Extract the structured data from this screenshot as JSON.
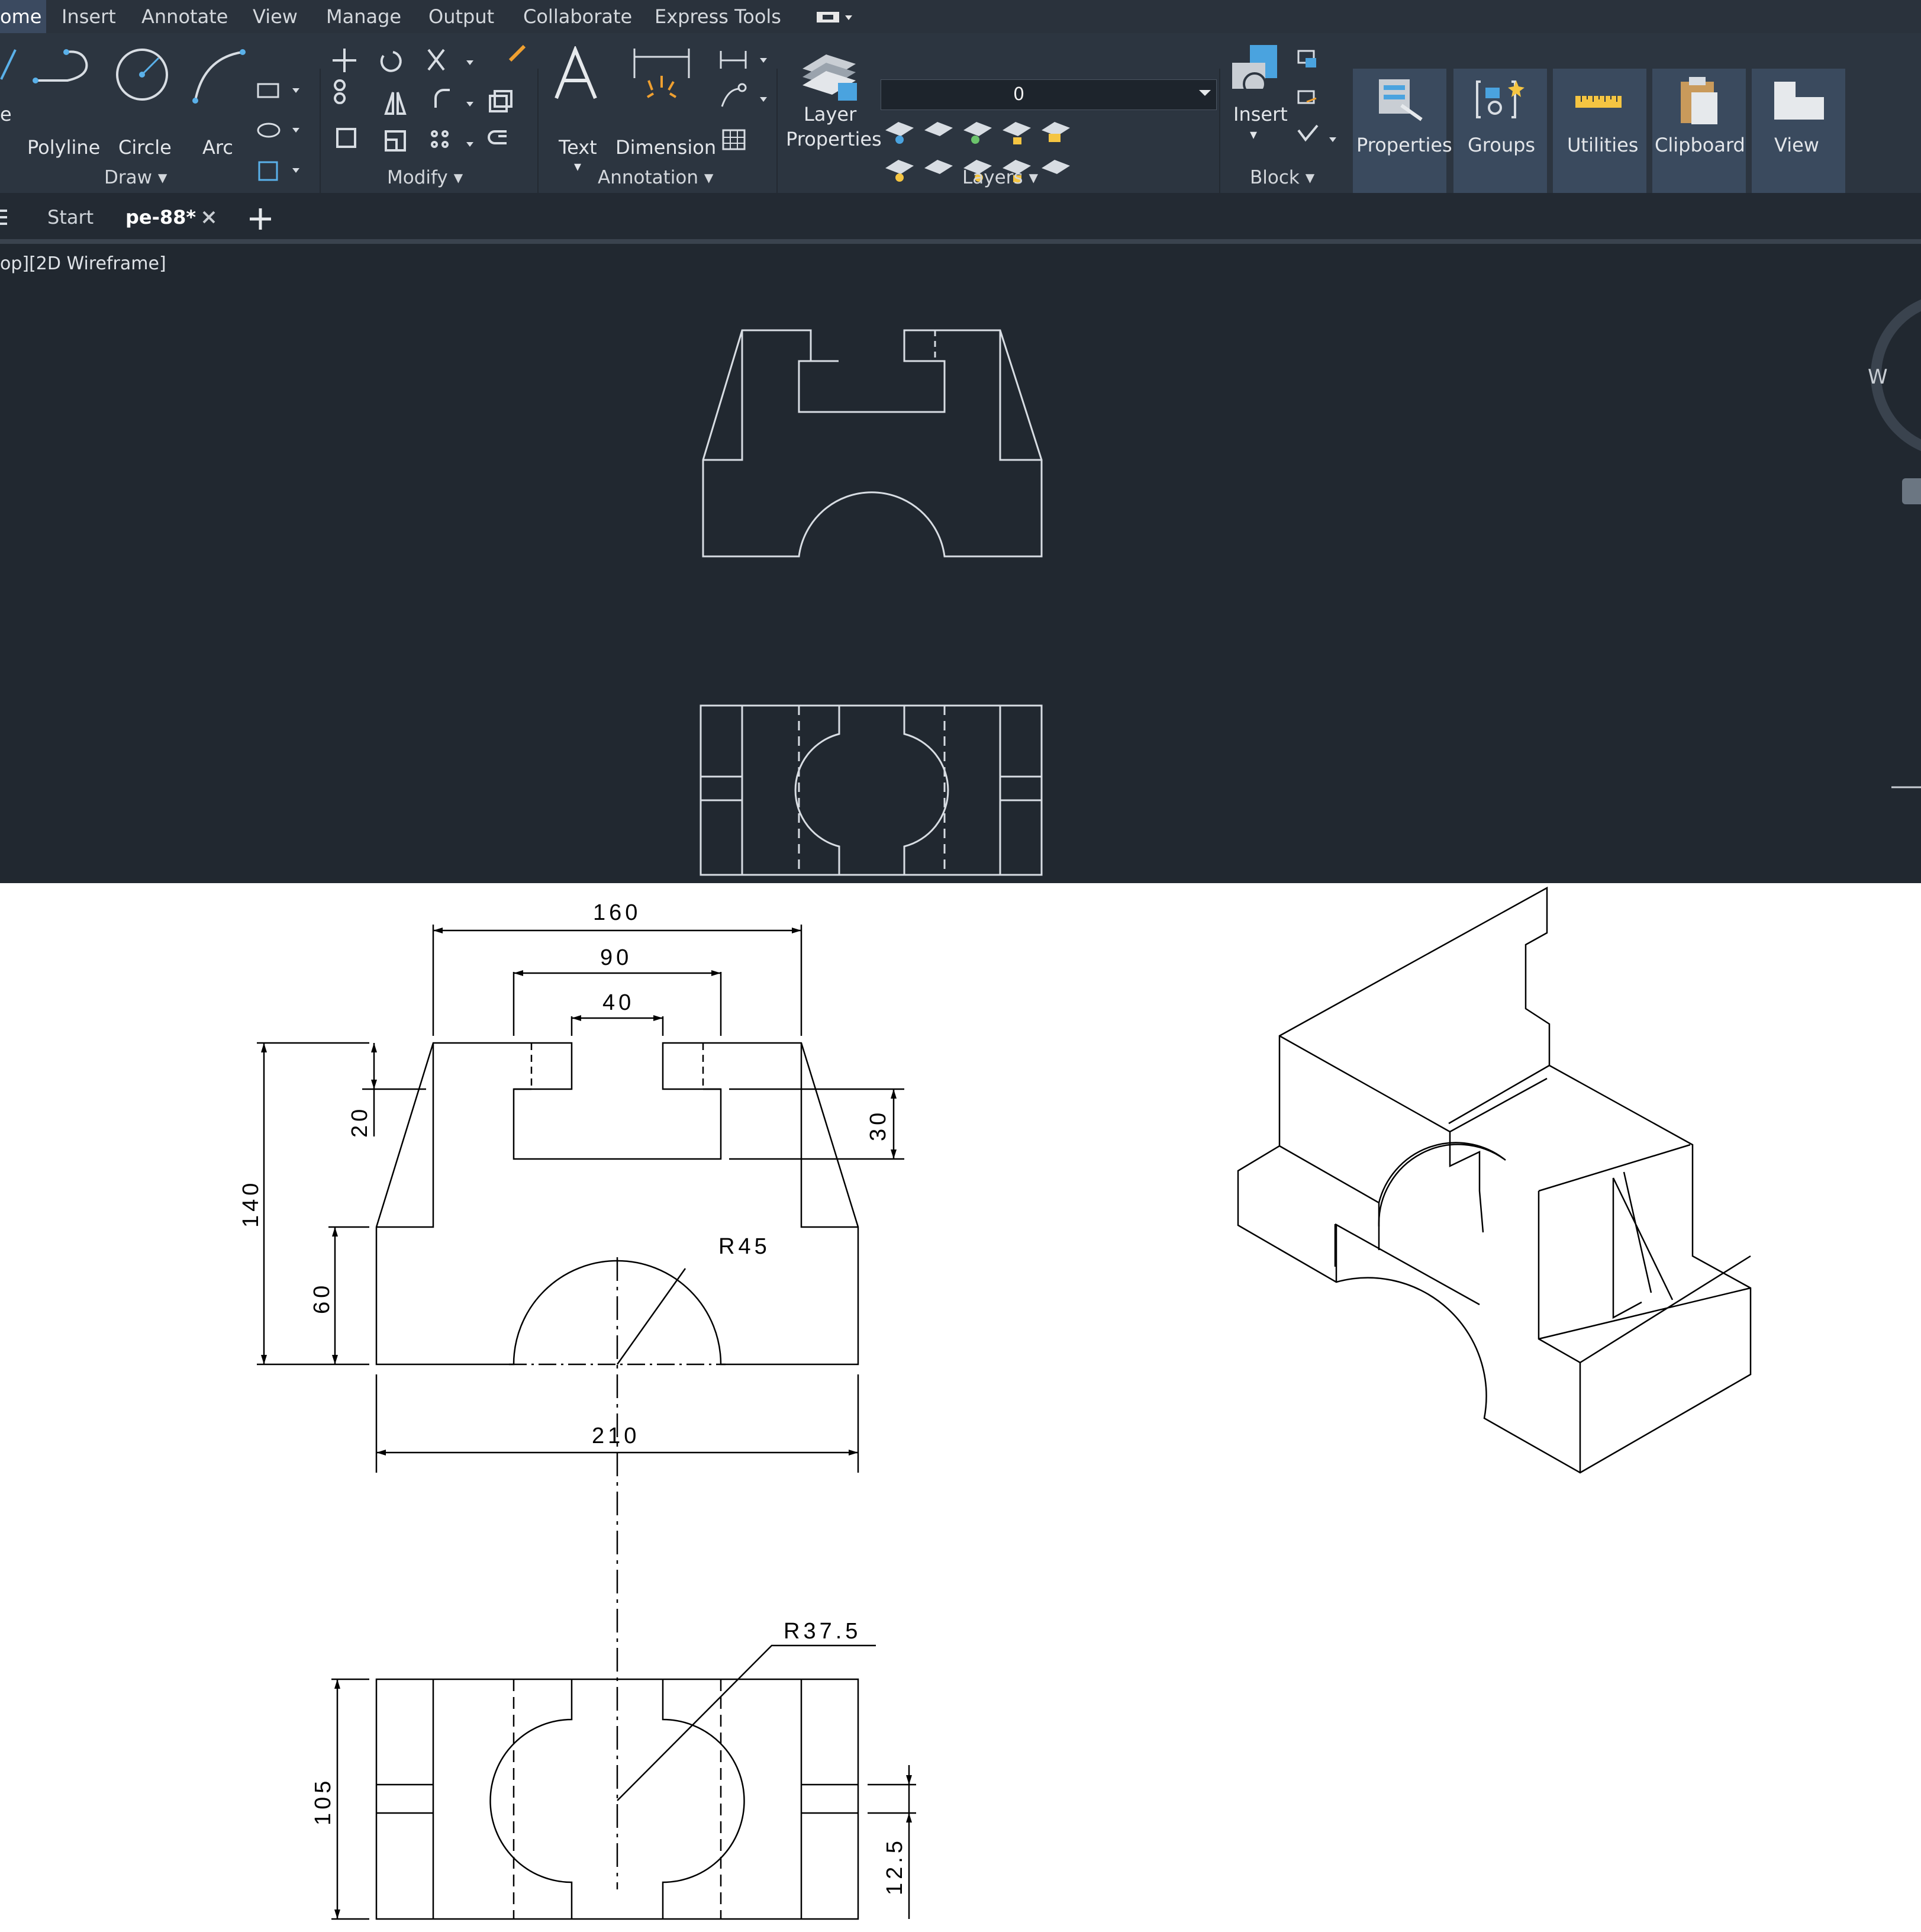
{
  "menu": [
    "ome",
    "Insert",
    "Annotate",
    "View",
    "Manage",
    "Output",
    "Collaborate",
    "Express Tools"
  ],
  "ribbon": {
    "draw": {
      "line": "e",
      "polyline": "Polyline",
      "circle": "Circle",
      "arc": "Arc",
      "panel": "Draw"
    },
    "modify": {
      "panel": "Modify"
    },
    "annotation": {
      "text": "Text",
      "dimension": "Dimension",
      "panel": "Annotation"
    },
    "layers": {
      "layer_properties_1": "Layer",
      "layer_properties_2": "Properties",
      "current_layer": "0",
      "panel": "Layers"
    },
    "block": {
      "insert": "Insert",
      "panel": "Block"
    },
    "properties": "Properties",
    "groups": "Groups",
    "utilities": "Utilities",
    "clipboard": "Clipboard",
    "view": "View"
  },
  "tabs": {
    "start": "Start",
    "drawing": "pe-88*"
  },
  "viewport_label": "op][2D Wireframe]",
  "viewcube_letter": "W",
  "drawing": {
    "front_view_dims": {
      "overall_width": "160",
      "slot_outer": "90",
      "slot_inner": "40",
      "step_height": "20",
      "slot_depth": "30",
      "total_height": "140",
      "base_height": "60",
      "arc_radius": "R45",
      "base_width": "210"
    },
    "top_view_dims": {
      "arc_radius": "R37.5",
      "depth": "105",
      "slot_width": "12.5"
    }
  },
  "colors": {
    "workspace": "#212830",
    "ribbon": "#2c3540",
    "menubar": "#2a323c",
    "accent_blue": "#4aa3df",
    "wire": "#d8dde3"
  }
}
